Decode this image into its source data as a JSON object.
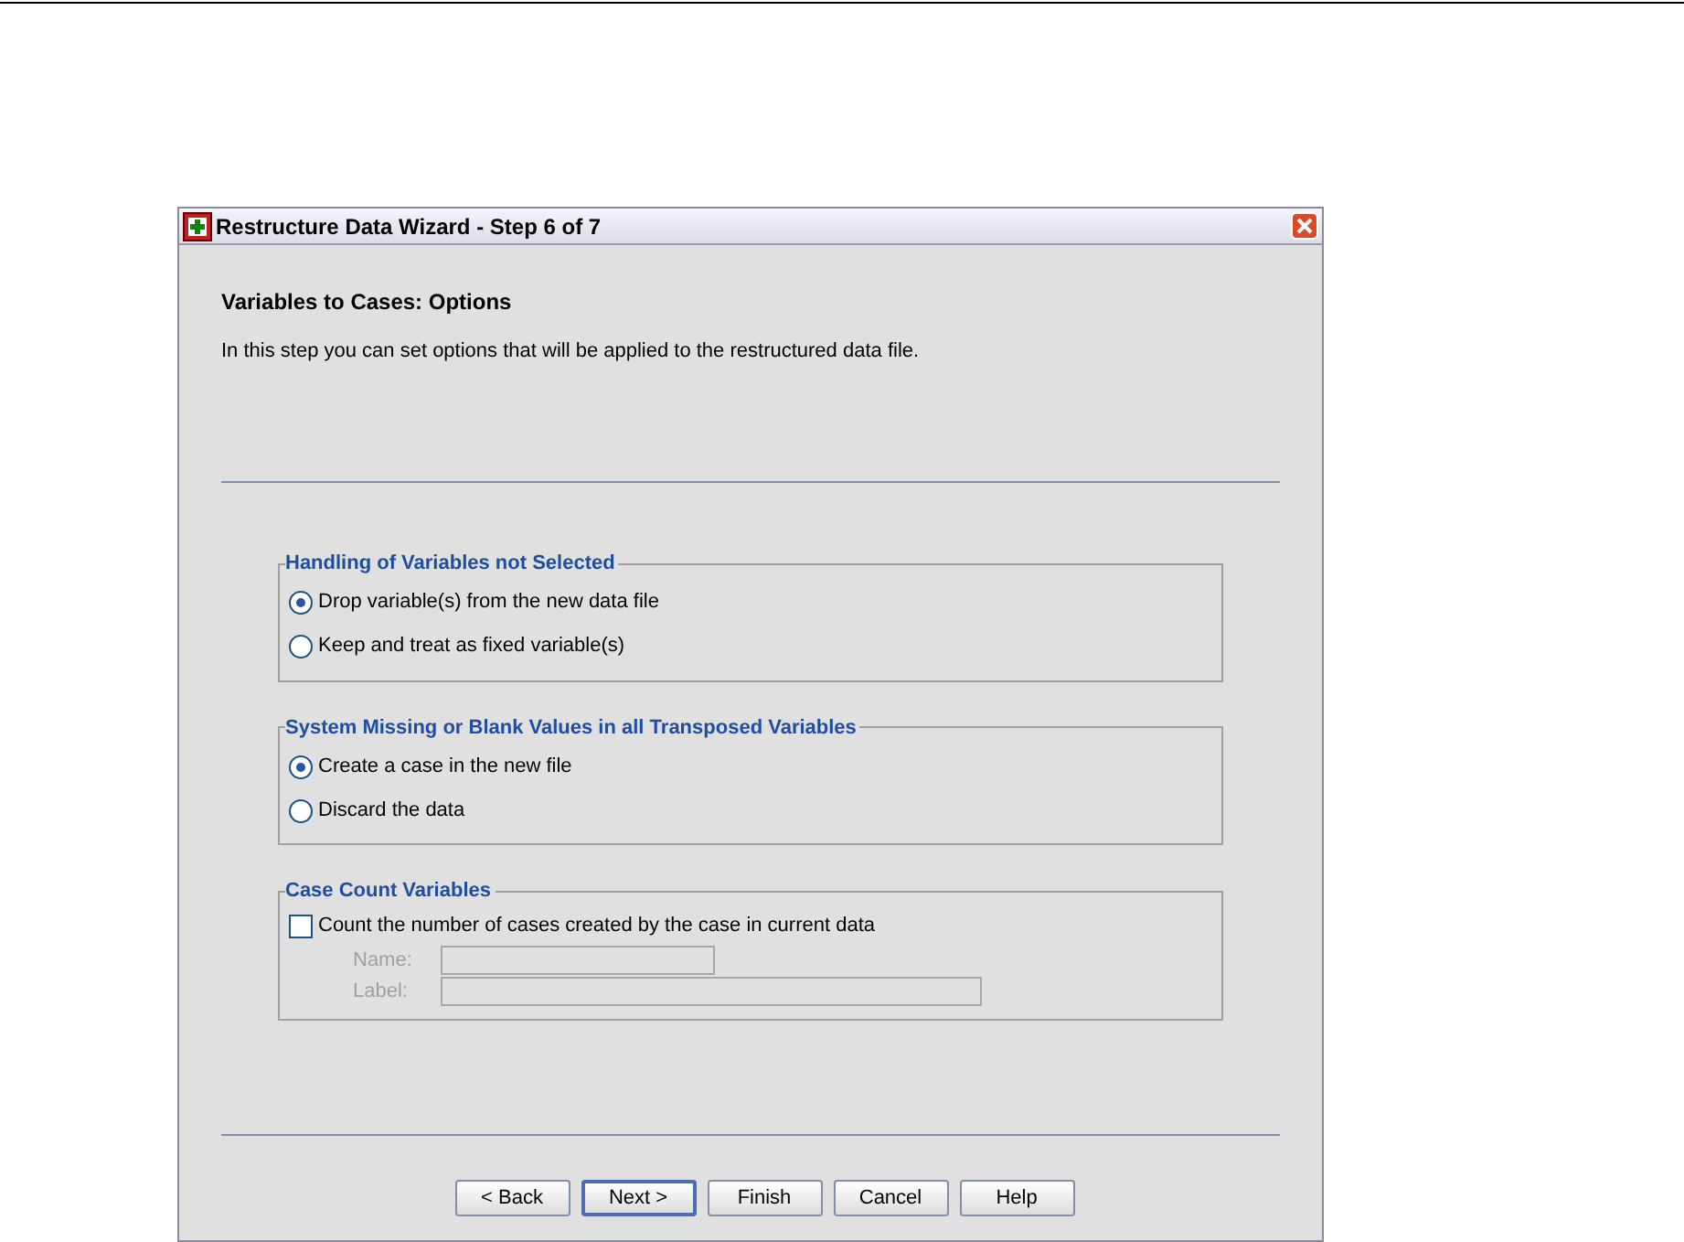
{
  "window": {
    "title": "Restructure Data Wizard - Step 6 of 7"
  },
  "heading": "Variables to Cases: Options",
  "description": "In this step you can set options that will be applied to the restructured data file.",
  "groups": [
    {
      "title": "Handling of Variables not Selected",
      "kind": "radio",
      "options": [
        {
          "label": "Drop variable(s) from the new data file",
          "selected": true
        },
        {
          "label": "Keep and treat as fixed variable(s)",
          "selected": false
        }
      ]
    },
    {
      "title": "System Missing or Blank Values in all Transposed Variables",
      "kind": "radio",
      "options": [
        {
          "label": "Create a case in the new file",
          "selected": true
        },
        {
          "label": "Discard the data",
          "selected": false
        }
      ]
    },
    {
      "title": "Case Count Variables",
      "kind": "checkbox",
      "checkbox": {
        "label": "Count the number of cases created by the case in current data",
        "checked": false
      },
      "fields": [
        {
          "label": "Name:",
          "disabled": true,
          "wide": false
        },
        {
          "label": "Label:",
          "disabled": true,
          "wide": true
        }
      ]
    }
  ],
  "buttons": [
    {
      "label": "< Back",
      "default": false
    },
    {
      "label": "Next >",
      "default": true
    },
    {
      "label": "Finish",
      "default": false
    },
    {
      "label": "Cancel",
      "default": false
    },
    {
      "label": "Help",
      "default": false
    }
  ]
}
